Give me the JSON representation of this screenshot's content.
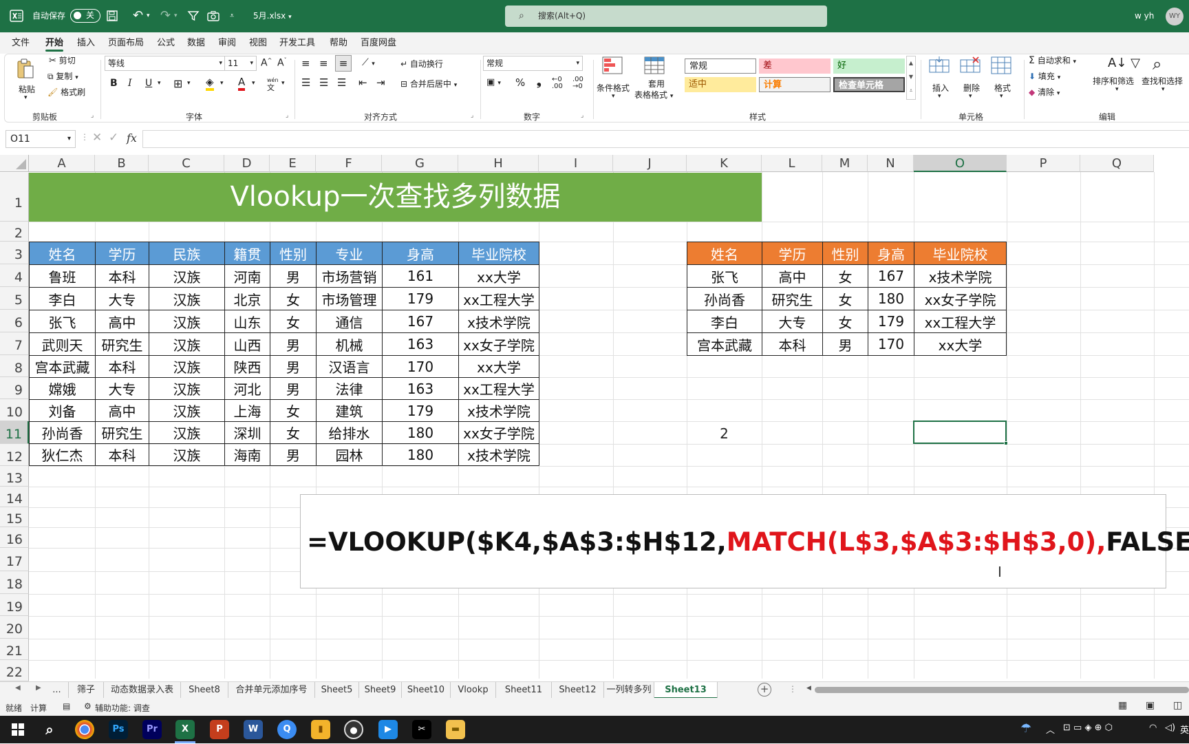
{
  "titlebar": {
    "autosave_label": "自动保存",
    "autosave_state": "关",
    "file_name": "5月.xlsx",
    "search_placeholder": "搜索(Alt+Q)",
    "user": "w yh"
  },
  "menu": [
    "文件",
    "开始",
    "插入",
    "页面布局",
    "公式",
    "数据",
    "审阅",
    "视图",
    "开发工具",
    "帮助",
    "百度网盘"
  ],
  "ribbon": {
    "clipboard": {
      "paste": "粘贴",
      "cut": "剪切",
      "copy": "复制",
      "format_painter": "格式刷",
      "group": "剪贴板"
    },
    "font": {
      "family": "等线",
      "size": "11",
      "group": "字体"
    },
    "alignment": {
      "wrap": "自动换行",
      "merge": "合并后居中",
      "group": "对齐方式"
    },
    "number": {
      "format": "常规",
      "group": "数字"
    },
    "styles": {
      "conditional": "条件格式",
      "table_line1": "套用",
      "table_line2": "表格格式",
      "normal": "常规",
      "bad": "差",
      "good": "好",
      "neutral": "适中",
      "calculation": "计算",
      "check_cell": "检查单元格",
      "group": "样式"
    },
    "cells": {
      "insert": "插入",
      "delete": "删除",
      "format": "格式",
      "group": "单元格"
    },
    "editing": {
      "autosum": "自动求和",
      "fill": "填充",
      "clear": "清除",
      "sort": "排序和筛选",
      "find": "查找和选择",
      "group": "编辑"
    }
  },
  "namebox": "O11",
  "columns": [
    "A",
    "B",
    "C",
    "D",
    "E",
    "F",
    "G",
    "H",
    "I",
    "J",
    "K",
    "L",
    "M",
    "N",
    "O",
    "P",
    "Q"
  ],
  "rows": [
    "1",
    "2",
    "3",
    "4",
    "5",
    "6",
    "7",
    "8",
    "9",
    "10",
    "11",
    "12",
    "13",
    "14",
    "15",
    "16",
    "17",
    "18",
    "19",
    "20",
    "21",
    "22"
  ],
  "sheet_title": "Vlookup一次查找多列数据",
  "main_table": {
    "headers": [
      "姓名",
      "学历",
      "民族",
      "籍贯",
      "性别",
      "专业",
      "身高",
      "毕业院校"
    ],
    "rows": [
      [
        "鲁班",
        "本科",
        "汉族",
        "河南",
        "男",
        "市场营销",
        "161",
        "xx大学"
      ],
      [
        "李白",
        "大专",
        "汉族",
        "北京",
        "女",
        "市场管理",
        "179",
        "xx工程大学"
      ],
      [
        "张飞",
        "高中",
        "汉族",
        "山东",
        "女",
        "通信",
        "167",
        "x技术学院"
      ],
      [
        "武则天",
        "研究生",
        "汉族",
        "山西",
        "男",
        "机械",
        "163",
        "xx女子学院"
      ],
      [
        "宫本武藏",
        "本科",
        "汉族",
        "陕西",
        "男",
        "汉语言",
        "170",
        "xx大学"
      ],
      [
        "嫦娥",
        "大专",
        "汉族",
        "河北",
        "男",
        "法律",
        "163",
        "xx工程大学"
      ],
      [
        "刘备",
        "高中",
        "汉族",
        "上海",
        "女",
        "建筑",
        "179",
        "x技术学院"
      ],
      [
        "孙尚香",
        "研究生",
        "汉族",
        "深圳",
        "女",
        "给排水",
        "180",
        "xx女子学院"
      ],
      [
        "狄仁杰",
        "本科",
        "汉族",
        "海南",
        "男",
        "园林",
        "180",
        "x技术学院"
      ]
    ]
  },
  "lookup_table": {
    "headers": [
      "姓名",
      "学历",
      "性别",
      "身高",
      "毕业院校"
    ],
    "rows": [
      [
        "张飞",
        "高中",
        "女",
        "167",
        "x技术学院"
      ],
      [
        "孙尚香",
        "研究生",
        "女",
        "180",
        "xx女子学院"
      ],
      [
        "李白",
        "大专",
        "女",
        "179",
        "xx工程大学"
      ],
      [
        "宫本武藏",
        "本科",
        "男",
        "170",
        "xx大学"
      ]
    ]
  },
  "cell_k11": "2",
  "formula": {
    "part1": "=VLOOKUP($K4,$A$3:$H$12,",
    "part2": "MATCH(L$3,$A$3:$H$3,0),",
    "part3": "FALSE)"
  },
  "sheet_tabs": [
    "...",
    "筛子",
    "动态数据录入表",
    "Sheet8",
    "合并单元添加序号",
    "Sheet5",
    "Sheet9",
    "Sheet10",
    "Vlookp",
    "Sheet11",
    "Sheet12",
    "一列转多列",
    "Sheet13"
  ],
  "active_tab": "Sheet13",
  "status": {
    "ready": "就绪",
    "calc": "计算",
    "accessibility": "辅助功能: 调查"
  },
  "colors": {
    "excel_green": "#1e7145",
    "title_band": "#70ad47",
    "main_header": "#5b9bd5",
    "lookup_header": "#ed7d31",
    "formula_red": "#e0151b"
  }
}
